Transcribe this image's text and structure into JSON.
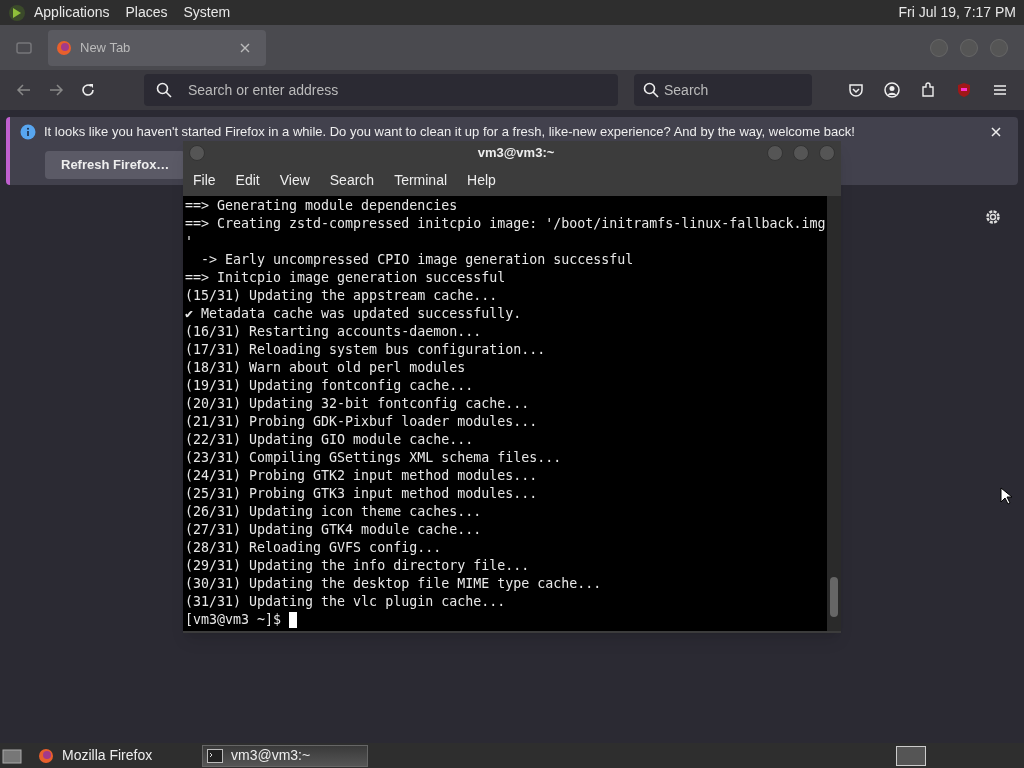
{
  "top_panel": {
    "menus": [
      "Applications",
      "Places",
      "System"
    ],
    "clock": "Fri Jul 19,  7:17 PM"
  },
  "browser": {
    "tabs": [
      {
        "label": "New Tab",
        "selected": true
      }
    ],
    "address": {
      "placeholder": "Search or enter address"
    },
    "search": {
      "placeholder": "Search"
    },
    "notification": {
      "message": "It looks like you haven't started Firefox in a while. Do you want to clean it up for a fresh, like-new experience? And by the way, welcome back!",
      "button": "Refresh Firefox…"
    }
  },
  "terminal": {
    "title": "vm3@vm3:~",
    "menus": [
      "File",
      "Edit",
      "View",
      "Search",
      "Terminal",
      "Help"
    ],
    "lines": [
      "==> Generating module dependencies",
      "==> Creating zstd-compressed initcpio image: '/boot/initramfs-linux-fallback.img",
      "'",
      "  -> Early uncompressed CPIO image generation successful",
      "==> Initcpio image generation successful",
      "(15/31) Updating the appstream cache...",
      "✔ Metadata cache was updated successfully.",
      "(16/31) Restarting accounts-daemon...",
      "(17/31) Reloading system bus configuration...",
      "(18/31) Warn about old perl modules",
      "(19/31) Updating fontconfig cache...",
      "(20/31) Updating 32-bit fontconfig cache...",
      "(21/31) Probing GDK-Pixbuf loader modules...",
      "(22/31) Updating GIO module cache...",
      "(23/31) Compiling GSettings XML schema files...",
      "(24/31) Probing GTK2 input method modules...",
      "(25/31) Probing GTK3 input method modules...",
      "(26/31) Updating icon theme caches...",
      "(27/31) Updating GTK4 module cache...",
      "(28/31) Reloading GVFS config...",
      "(29/31) Updating the info directory file...",
      "(30/31) Updating the desktop file MIME type cache...",
      "(31/31) Updating the vlc plugin cache..."
    ],
    "prompt": "[vm3@vm3 ~]$"
  },
  "taskbar": {
    "items": [
      {
        "label": "Mozilla Firefox",
        "selected": false,
        "kind": "browser"
      },
      {
        "label": "vm3@vm3:~",
        "selected": true,
        "kind": "terminal"
      }
    ]
  }
}
